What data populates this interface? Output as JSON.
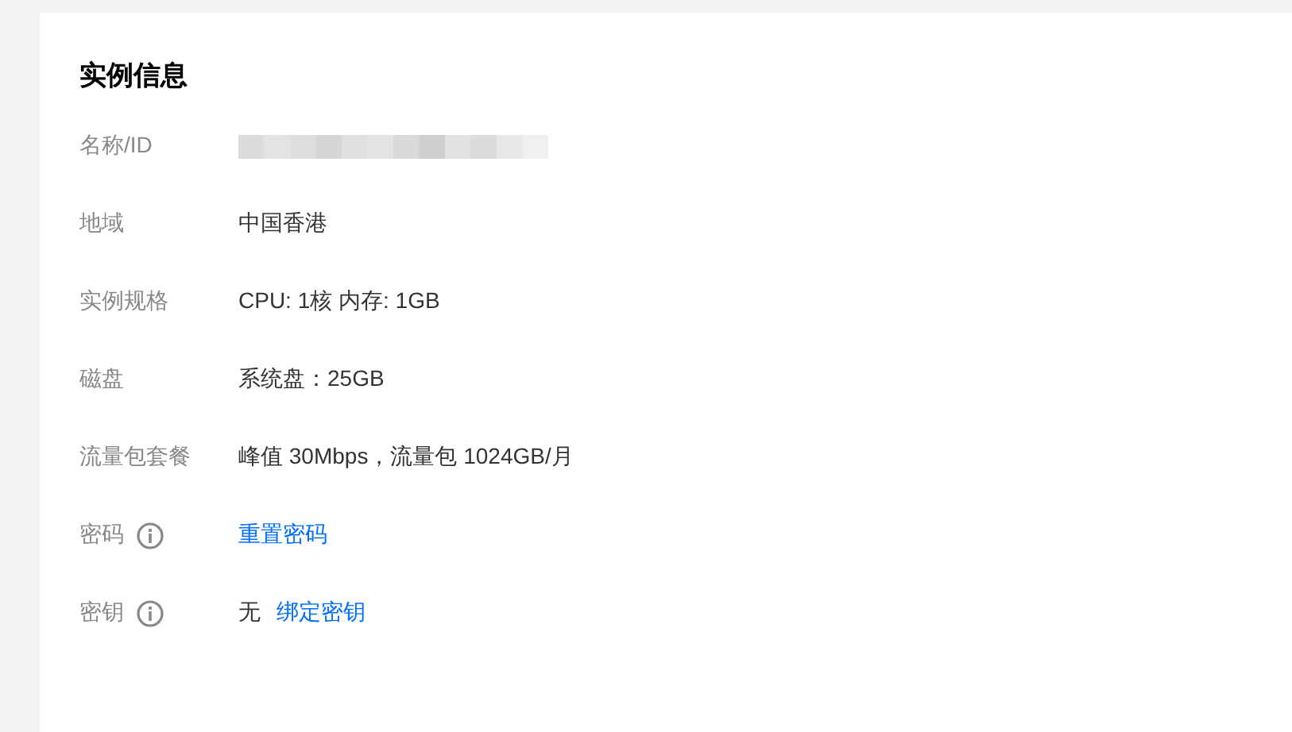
{
  "card": {
    "title": "实例信息",
    "rows": [
      {
        "label": "名称/ID",
        "info": false,
        "value": [
          {
            "kind": "masked"
          }
        ]
      },
      {
        "label": "地域",
        "info": false,
        "value": [
          {
            "kind": "text",
            "text": "中国香港"
          }
        ]
      },
      {
        "label": "实例规格",
        "info": false,
        "value": [
          {
            "kind": "text",
            "text": "CPU: 1核 内存: 1GB"
          }
        ]
      },
      {
        "label": "磁盘",
        "info": false,
        "value": [
          {
            "kind": "text",
            "text": "系统盘：25GB"
          }
        ]
      },
      {
        "label": "流量包套餐",
        "info": false,
        "value": [
          {
            "kind": "text",
            "text": "峰值 30Mbps，流量包 1024GB/月"
          }
        ]
      },
      {
        "label": "密码",
        "info": true,
        "value": [
          {
            "kind": "link",
            "text": "重置密码"
          }
        ]
      },
      {
        "label": "密钥",
        "info": true,
        "value": [
          {
            "kind": "text",
            "text": "无"
          },
          {
            "kind": "link",
            "text": "绑定密钥"
          }
        ]
      }
    ]
  }
}
